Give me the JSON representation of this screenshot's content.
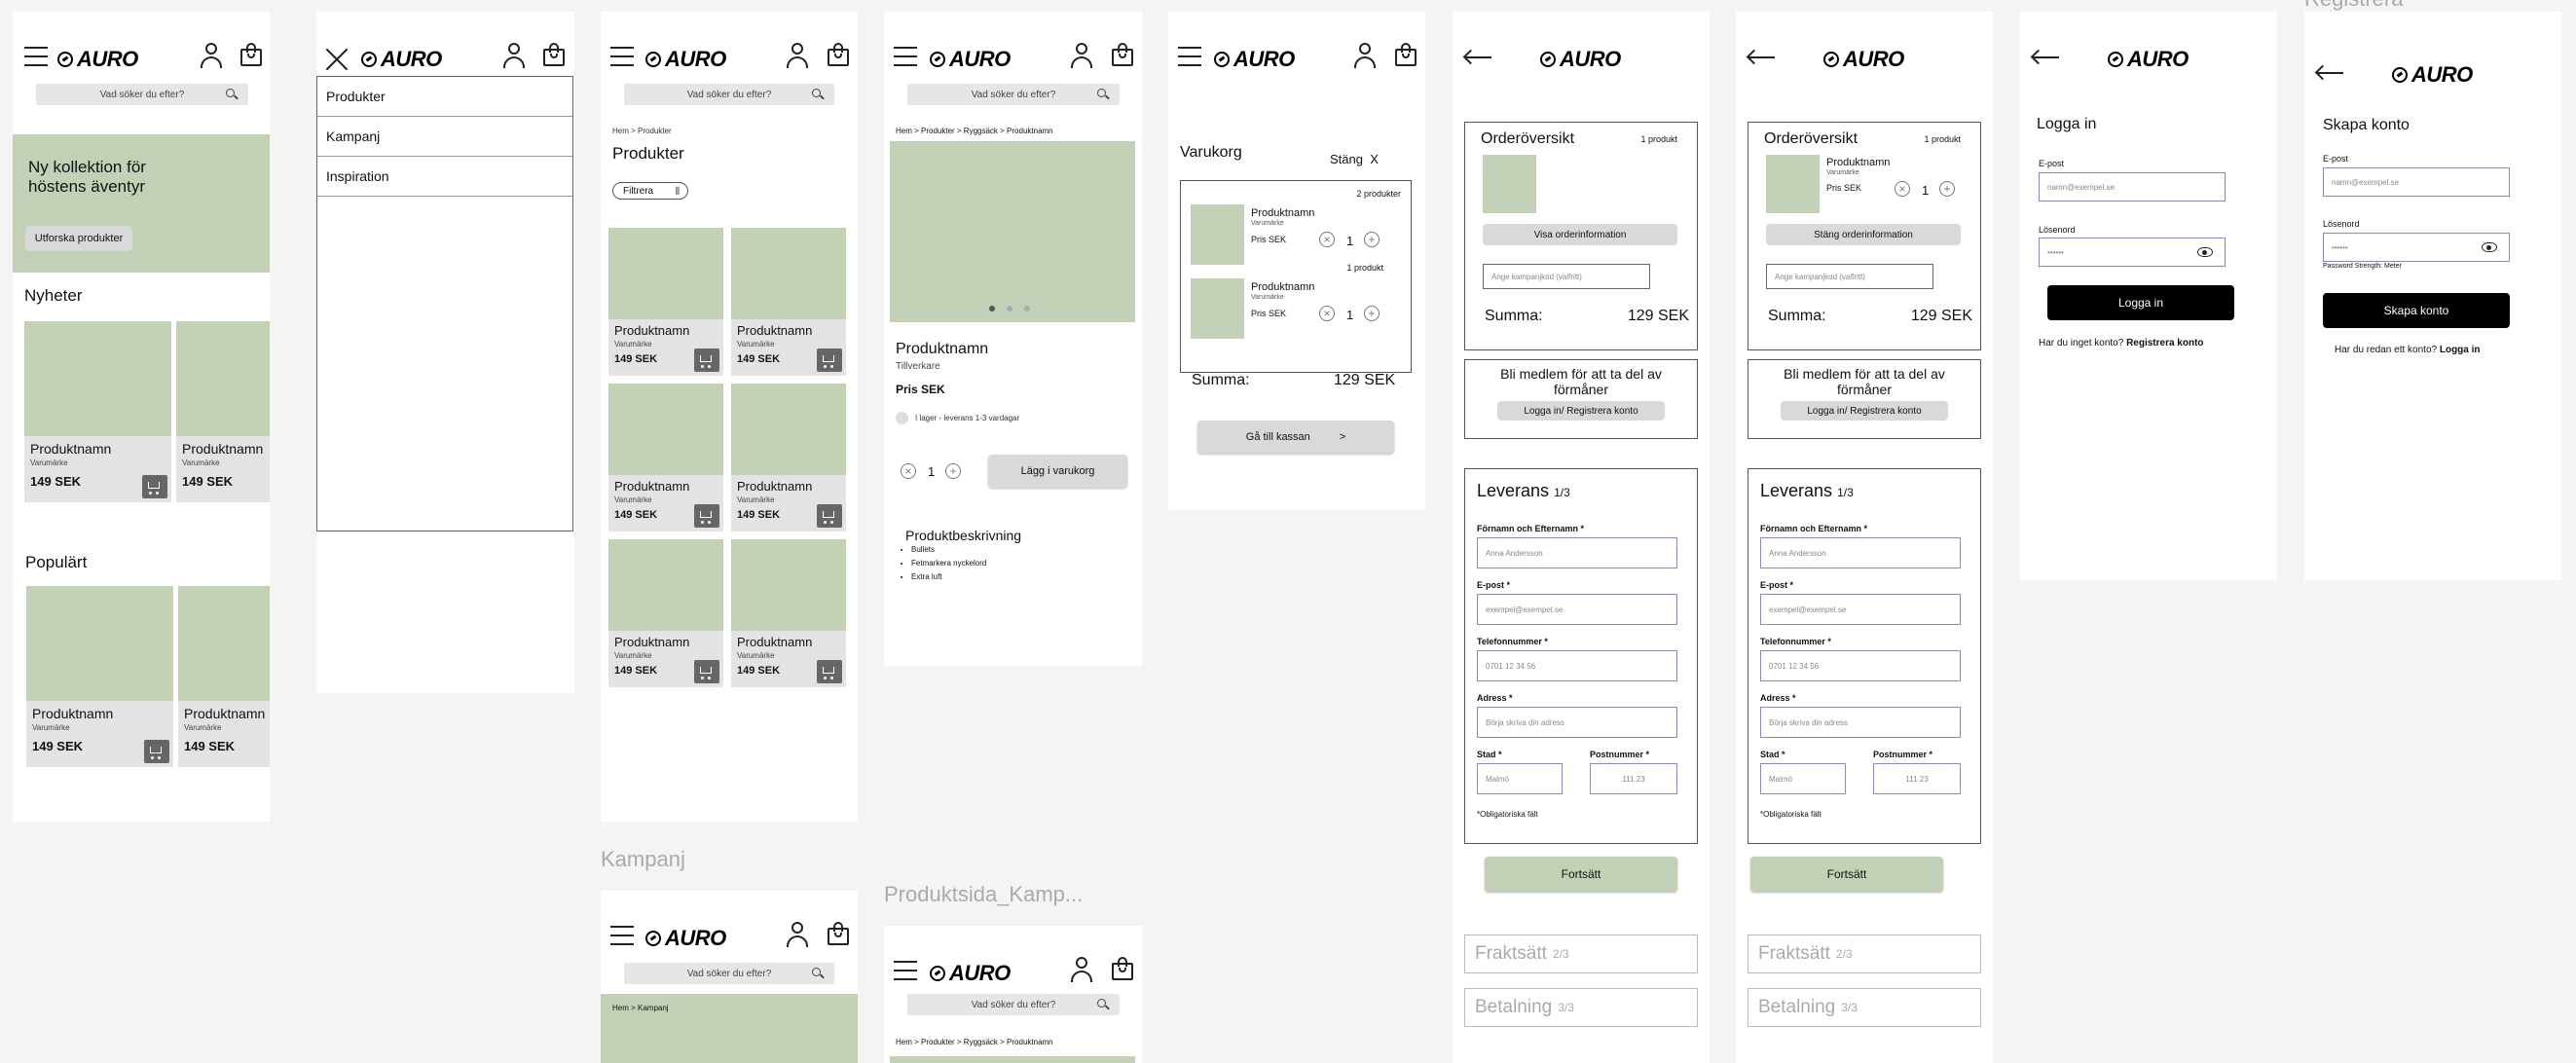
{
  "brand": "AURO",
  "search_placeholder": "Vad söker du efter?",
  "home": {
    "hero_title_1": "Ny kollektion för",
    "hero_title_2": "höstens äventyr",
    "hero_button": "Utforska produkter",
    "news_heading": "Nyheter",
    "popular_heading": "Populärt"
  },
  "product": {
    "name": "Produktnamn",
    "brand": "Varumärke",
    "price": "149 SEK"
  },
  "menu": {
    "items": [
      "Produkter",
      "Kampanj",
      "Inspiration"
    ]
  },
  "listing": {
    "breadcrumb": "Hem > Produkter",
    "title": "Produkter",
    "filter": "Filtrera"
  },
  "detail": {
    "breadcrumb": "Hem > Produkter > Ryggsäck > Produktnamn",
    "name": "Produktnamn",
    "maker": "Tillverkare",
    "price": "Pris SEK",
    "stock": "I lager - leverans 1-3 vardagar",
    "qty": "1",
    "add_button": "Lägg i varukorg",
    "desc_title": "Produktbeskrivning",
    "bullets": [
      "Bullets",
      "Fetmarkera nyckelord",
      "Extra luft"
    ]
  },
  "cart": {
    "title": "Varukorg",
    "close": "Stäng",
    "close_x": "X",
    "count_two": "2 produkter",
    "count_one": "1 produkt",
    "item_name": "Produktnamn",
    "item_brand": "Varumärke",
    "item_price": "Pris SEK",
    "qty": "1",
    "sum_label": "Summa:",
    "sum_value": "129 SEK",
    "checkout": "Gå till kassan",
    "checkout_arrow": ">"
  },
  "checkout": {
    "overview": "Orderöversikt",
    "count": "1 produkt",
    "item_name": "Produktnamn",
    "item_brand": "Varumärke",
    "item_price": "Pris SEK",
    "qty": "1",
    "show_info": "Visa orderinformation",
    "close_info": "Stäng orderinformation",
    "promo_placeholder": "Ange kampanjkod (valfritt)",
    "sum_label": "Summa:",
    "sum_value": "129 SEK",
    "member_text_1": "Bli medlem för att ta del av",
    "member_text_2": "förmåner",
    "member_button": "Logga in/ Registrera konto",
    "delivery_title": "Leverans",
    "delivery_step": "1/3",
    "name_label": "Förnamn och Efternamn *",
    "name_placeholder": "Anna Andersson",
    "email_label": "E-post *",
    "email_placeholder": "exempel@exempel.se",
    "phone_label": "Telefonnummer *",
    "phone_placeholder": "0701 12 34 56",
    "address_label": "Adress *",
    "address_placeholder": "Börja skriva din adress",
    "city_label": "Stad *",
    "city_placeholder": "Malmö",
    "zip_label": "Postnummer *",
    "zip_placeholder": "111 23",
    "required_note": "*Obligatoriska fält",
    "continue": "Fortsätt",
    "shipping_title": "Fraktsätt",
    "shipping_step": "2/3",
    "payment_title": "Betalning",
    "payment_step": "3/3"
  },
  "login": {
    "title": "Logga in",
    "email_label": "E-post",
    "email_placeholder": "namn@exempel.se",
    "password_label": "Lösenord",
    "password_placeholder": "••••••",
    "button": "Logga in",
    "no_account": "Har du inget konto?",
    "register_link": "Registrera konto"
  },
  "register": {
    "partial_section_label": "Registrera",
    "title": "Skapa konto",
    "email_label": "E-post",
    "email_placeholder": "namn@exempel.se",
    "password_label": "Lösenord",
    "password_placeholder": "••••••",
    "strength": "Password Strength: Meter",
    "button": "Skapa konto",
    "have_account": "Har du redan ett konto?",
    "login_link": "Logga in"
  },
  "kampanj": {
    "section_label": "Kampanj",
    "breadcrumb": "Hem > Kampanj"
  },
  "produktsida_kampanj": {
    "section_label": "Produktsida_Kamp..."
  },
  "colors": {
    "placeholder_green": "#c2d1b6",
    "card_grey": "#e3e3e3",
    "canvas": "#f4f4f4"
  }
}
